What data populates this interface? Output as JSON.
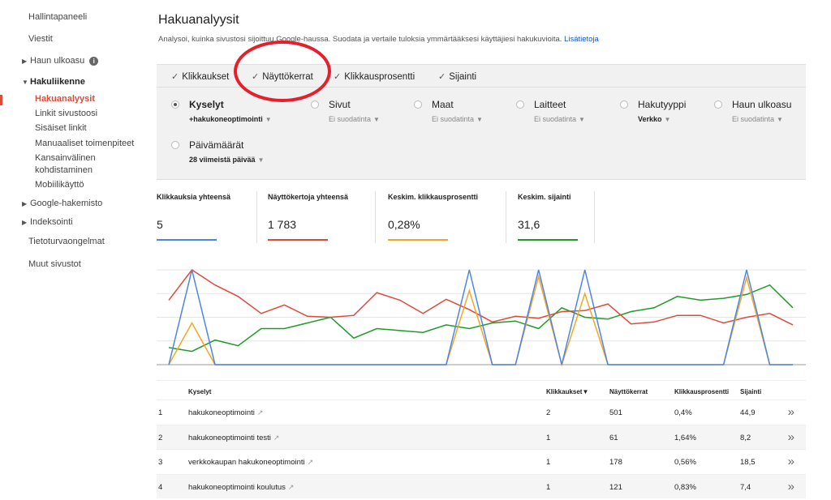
{
  "sidebar": {
    "dashboard": "Hallintapaneeli",
    "messages": "Viestit",
    "search_appearance": "Haun ulkoasu",
    "search_traffic": "Hakuliikenne",
    "sub_items": [
      "Hakuanalyysit",
      "Linkit sivustoosi",
      "Sisäiset linkit",
      "Manuaaliset toimenpiteet",
      "Kansainvälinen",
      "kohdistaminen",
      "Mobiilikäyttö"
    ],
    "google_index": "Google-hakemisto",
    "crawl": "Indeksointi",
    "security": "Tietoturvaongelmat",
    "other": "Muut sivustot"
  },
  "page": {
    "title": "Hakuanalyysit",
    "description": "Analysoi, kuinka sivustosi sijoittuu Google-haussa. Suodata ja vertaile tuloksia ymmärtääksesi käyttäjiesi hakukuvioita.",
    "learn_more": "Lisätietoja"
  },
  "metrics": {
    "clicks": "Klikkaukset",
    "impressions": "Näyttökerrat",
    "ctr": "Klikkausprosentti",
    "position": "Sijainti"
  },
  "filters": {
    "queries": {
      "label": "Kyselyt",
      "sub": "+hakukoneoptimointi"
    },
    "pages": {
      "label": "Sivut",
      "sub": "Ei suodatinta"
    },
    "countries": {
      "label": "Maat",
      "sub": "Ei suodatinta"
    },
    "devices": {
      "label": "Laitteet",
      "sub": "Ei suodatinta"
    },
    "search_type": {
      "label": "Hakutyyppi",
      "sub": "Verkko"
    },
    "appearance": {
      "label": "Haun ulkoasu",
      "sub": "Ei suodatinta"
    },
    "dates": {
      "label": "Päivämäärät",
      "sub": "28 viimeistä päivää"
    }
  },
  "stats": {
    "clicks": {
      "label": "Klikkauksia yhteensä",
      "value": "5"
    },
    "impressions": {
      "label": "Näyttökertoja yhteensä",
      "value": "1 783"
    },
    "ctr": {
      "label": "Keskim. klikkausprosentti",
      "value": "0,28%"
    },
    "position": {
      "label": "Keskim. sijainti",
      "value": "31,6"
    }
  },
  "colors": {
    "clicks": "#4a86e8",
    "impressions": "#dd4b39",
    "ctr": "#f6a623",
    "position": "#1e9c2a"
  },
  "chart_data": {
    "type": "line",
    "x": [
      1,
      2,
      3,
      4,
      5,
      6,
      7,
      8,
      9,
      10,
      11,
      12,
      13,
      14,
      15,
      16,
      17,
      18,
      19,
      20,
      21,
      22,
      23,
      24,
      25,
      26,
      27,
      28
    ],
    "series": [
      {
        "name": "Klikkaukset",
        "values": [
          0,
          1,
          0,
          0,
          0,
          0,
          0,
          0,
          0,
          0,
          0,
          0,
          0,
          1,
          0,
          0,
          1,
          0,
          1,
          0,
          0,
          0,
          0,
          0,
          0,
          1,
          0,
          0
        ]
      },
      {
        "name": "Näyttökerrat",
        "values": [
          68,
          100,
          84,
          72,
          54,
          63,
          51,
          50,
          52,
          76,
          68,
          54,
          69,
          58,
          45,
          51,
          49,
          56,
          57,
          64,
          43,
          45,
          52,
          52,
          44,
          50,
          54,
          42
        ]
      },
      {
        "name": "Klikkausprosentti",
        "values": [
          0,
          44,
          0,
          0,
          0,
          0,
          0,
          0,
          0,
          0,
          0,
          0,
          0,
          78,
          0,
          0,
          93,
          0,
          75,
          0,
          0,
          0,
          0,
          0,
          0,
          92,
          0,
          0
        ]
      },
      {
        "name": "Sijainti",
        "values": [
          9,
          7,
          13,
          10,
          19,
          19,
          22,
          25,
          14,
          19,
          18,
          17,
          21,
          19,
          22,
          23,
          19,
          30,
          25,
          24,
          28,
          30,
          36,
          34,
          35,
          37,
          42,
          30
        ]
      }
    ]
  },
  "table": {
    "headers": {
      "query": "Kyselyt",
      "clicks": "Klikkaukset▼",
      "impressions": "Näyttökerrat",
      "ctr": "Klikkausprosentti",
      "position": "Sijainti"
    },
    "rows": [
      {
        "num": "1",
        "query": "hakukoneoptimointi",
        "clicks": "2",
        "impressions": "501",
        "ctr": "0,4%",
        "position": "44,9"
      },
      {
        "num": "2",
        "query": "hakukoneoptimointi testi",
        "clicks": "1",
        "impressions": "61",
        "ctr": "1,64%",
        "position": "8,2"
      },
      {
        "num": "3",
        "query": "verkkokaupan hakukoneoptimointi",
        "clicks": "1",
        "impressions": "178",
        "ctr": "0,56%",
        "position": "18,5"
      },
      {
        "num": "4",
        "query": "hakukoneoptimointi koulutus",
        "clicks": "1",
        "impressions": "121",
        "ctr": "0,83%",
        "position": "7,4"
      }
    ]
  }
}
